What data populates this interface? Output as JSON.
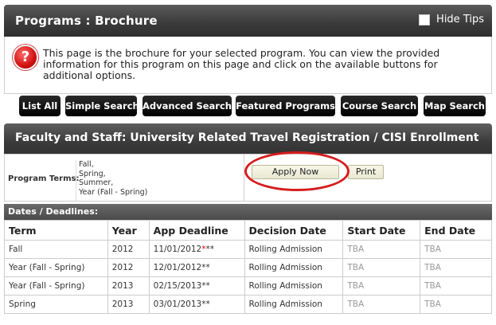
{
  "header": {
    "title": "Programs : Brochure",
    "hide_tips_label": "Hide Tips"
  },
  "tip": {
    "icon": "question-icon",
    "text": "This page is the brochure for your selected program. You can view the provided information for this program on this page and click on the available buttons for additional options."
  },
  "nav": {
    "list_all": "List All",
    "simple_search": "Simple Search",
    "advanced_search": "Advanced Search",
    "featured_programs": "Featured Programs",
    "course_search": "Course Search",
    "map_search": "Map Search"
  },
  "program": {
    "title": "Faculty and Staff: University Related Travel Registration / CISI Enrollment",
    "terms_label": "Program Terms:",
    "terms": [
      "Fall,",
      "Spring,",
      "Summer,",
      "Year (Fall - Spring)"
    ],
    "apply_label": "Apply Now",
    "print_label": "Print"
  },
  "dates": {
    "section_title": "Dates / Deadlines:",
    "columns": [
      "Term",
      "Year",
      "App Deadline",
      "Decision Date",
      "Start Date",
      "End Date"
    ],
    "rows": [
      {
        "term": "Fall",
        "year": "2012",
        "deadline": "11/01/2012",
        "deadline_mark": "*",
        "deadline_suffix": "**",
        "decision": "Rolling Admission",
        "start": "TBA",
        "end": "TBA"
      },
      {
        "term": "Year (Fall - Spring)",
        "year": "2012",
        "deadline": "12/01/2012",
        "deadline_mark": "",
        "deadline_suffix": "**",
        "decision": "Rolling Admission",
        "start": "TBA",
        "end": "TBA"
      },
      {
        "term": "Year (Fall - Spring)",
        "year": "2013",
        "deadline": "02/15/2013",
        "deadline_mark": "",
        "deadline_suffix": "**",
        "decision": "Rolling Admission",
        "start": "TBA",
        "end": "TBA"
      },
      {
        "term": "Spring",
        "year": "2013",
        "deadline": "03/01/2013",
        "deadline_mark": "",
        "deadline_suffix": "**",
        "decision": "Rolling Admission",
        "start": "TBA",
        "end": "TBA"
      }
    ]
  },
  "colors": {
    "highlight_oval": "#d61c1c",
    "required_star": "#e00000"
  }
}
